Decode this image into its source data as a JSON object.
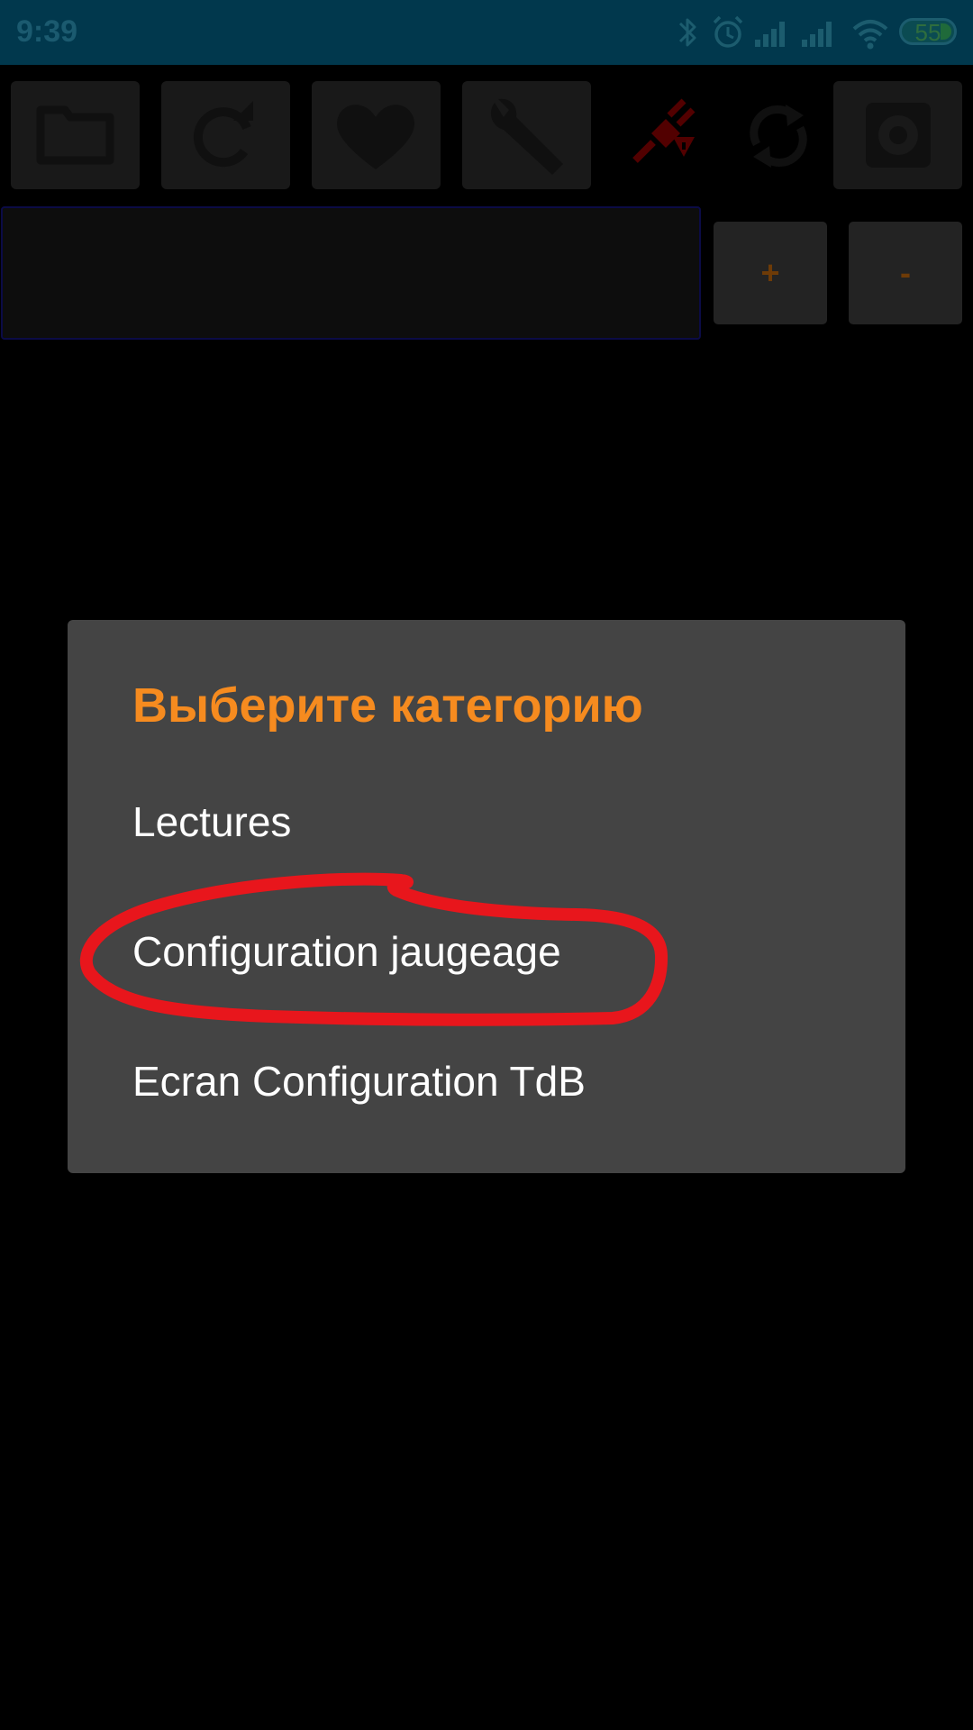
{
  "status_bar": {
    "time": "9:39",
    "battery": "55",
    "icons": [
      "bluetooth-icon",
      "alarm-icon",
      "signal-icon",
      "signal-icon",
      "wifi-icon",
      "battery-icon"
    ]
  },
  "toolbar": {
    "buttons": [
      {
        "icon": "folder-icon"
      },
      {
        "icon": "refresh-icon"
      },
      {
        "icon": "heart-icon"
      },
      {
        "icon": "wrench-icon"
      },
      {
        "icon": "disconnected-plug-icon"
      },
      {
        "icon": "sync-icon"
      },
      {
        "icon": "gear-icon"
      }
    ]
  },
  "value_row": {
    "input_value": "",
    "plus_label": "+",
    "minus_label": "-"
  },
  "dialog": {
    "title": "Выберите категорию",
    "items": [
      {
        "label": "Lectures"
      },
      {
        "label": "Configuration jaugeage"
      },
      {
        "label": "Ecran Configuration TdB"
      }
    ]
  },
  "colors": {
    "status_bar": "#01384d",
    "dialog_background": "#444444",
    "title_accent": "#f68b1f",
    "annotation_red": "#e8161c"
  }
}
